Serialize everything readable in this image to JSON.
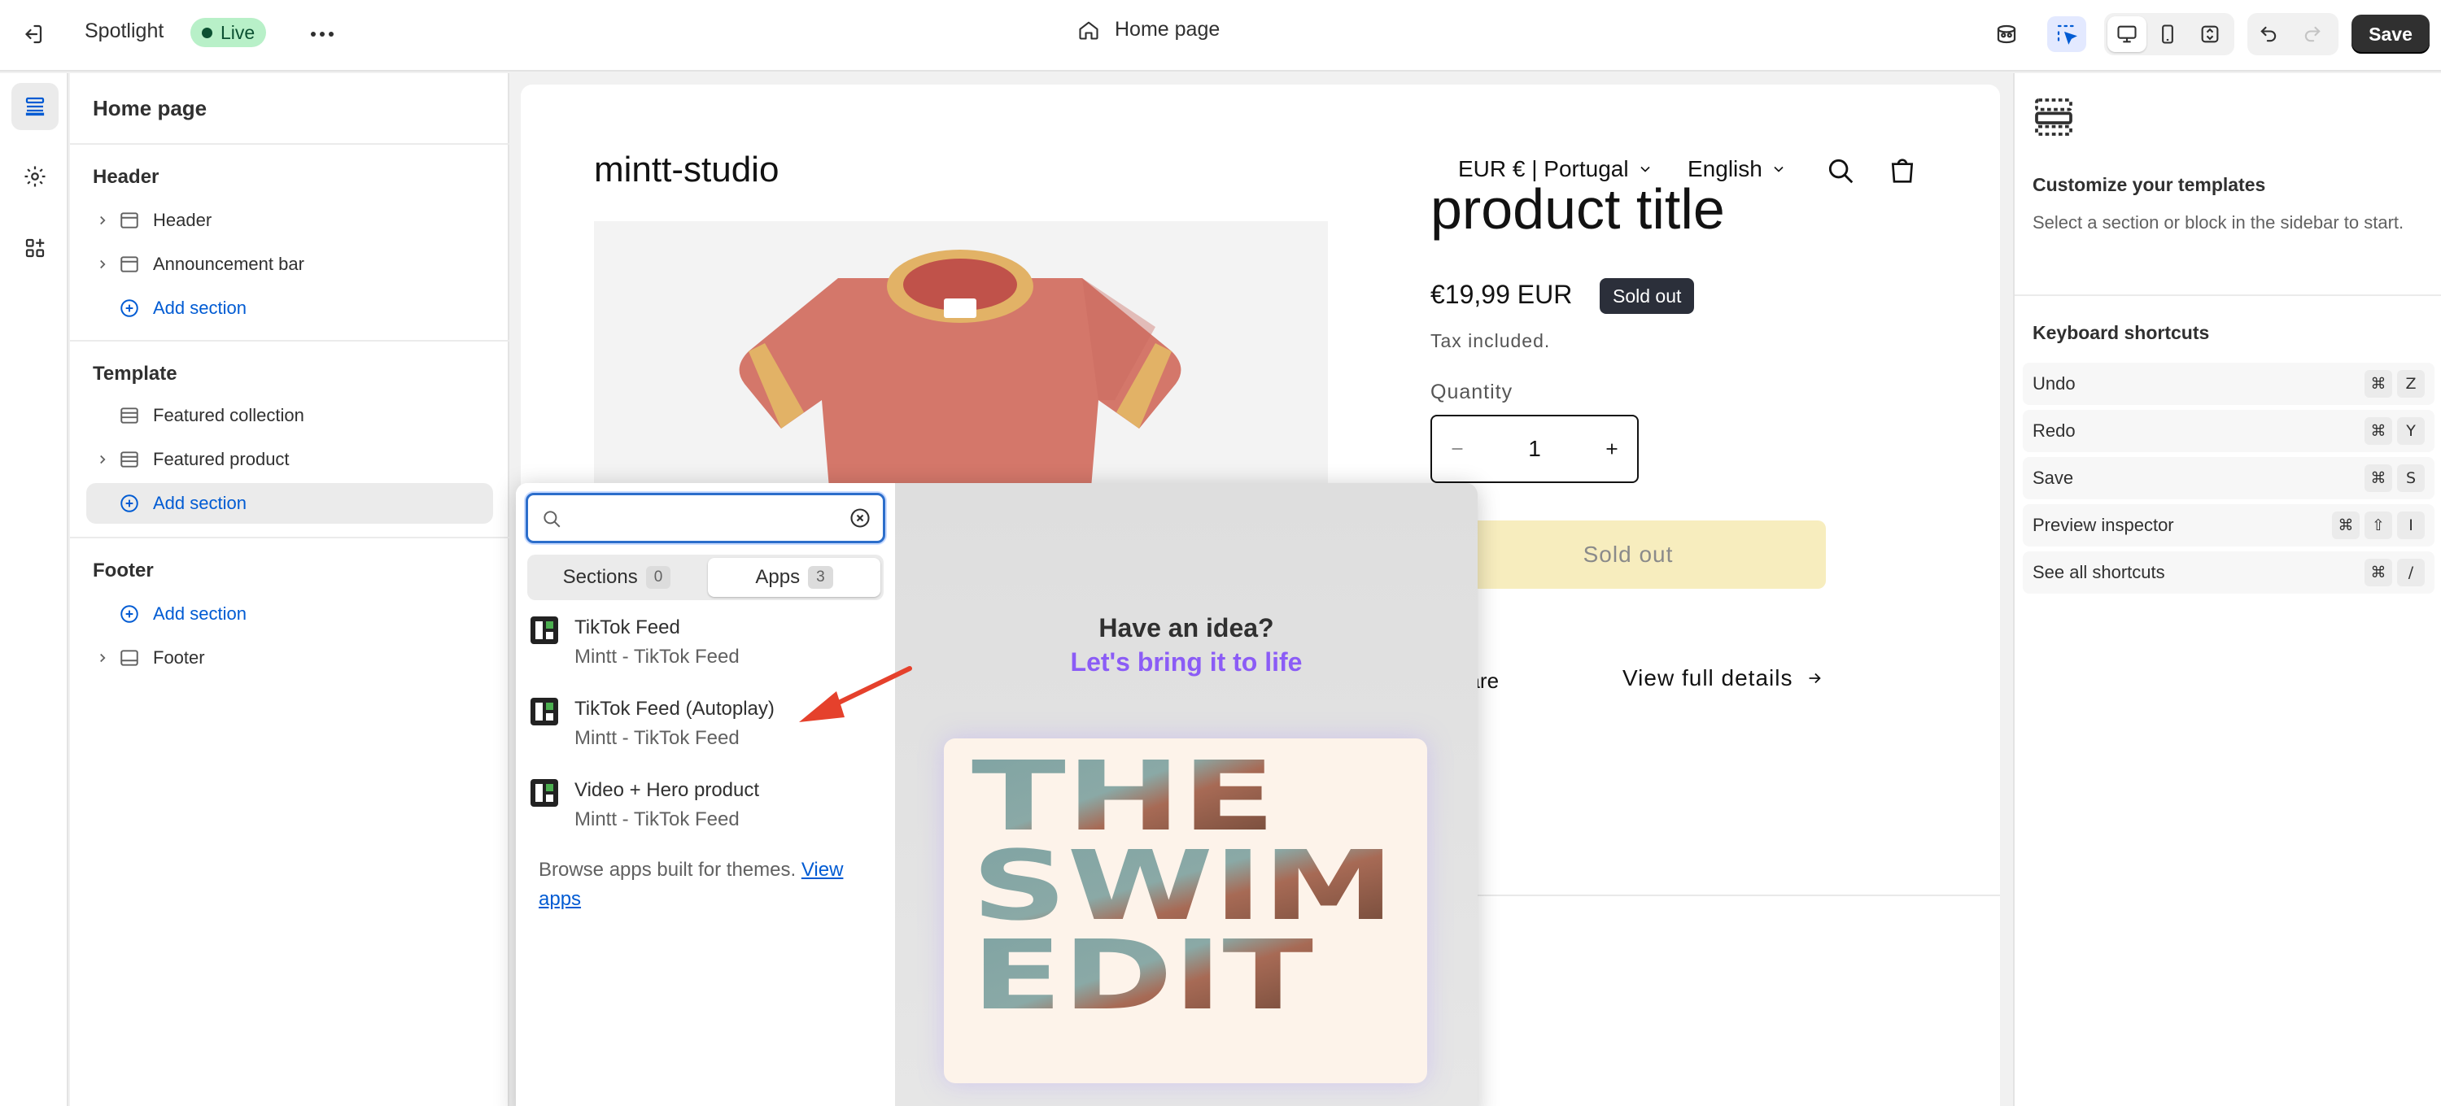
{
  "topbar": {
    "theme_name": "Spotlight",
    "live_badge": "Live",
    "page_selector": "Home page",
    "save_label": "Save"
  },
  "sidebar": {
    "title": "Home page",
    "groups": {
      "header": {
        "label": "Header",
        "items": [
          "Header",
          "Announcement bar"
        ],
        "add_label": "Add section"
      },
      "template": {
        "label": "Template",
        "items": [
          "Featured collection",
          "Featured product"
        ],
        "add_label": "Add section"
      },
      "footer": {
        "label": "Footer",
        "add_label": "Add section",
        "items": [
          "Footer"
        ]
      }
    }
  },
  "preview": {
    "store_name": "mintt-studio",
    "currency": "EUR € | Portugal",
    "language": "English",
    "product_title": "product title",
    "price": "€19,99 EUR",
    "sold_out_badge": "Sold out",
    "tax_note": "Tax included.",
    "quantity_label": "Quantity",
    "quantity_value": "1",
    "sold_out_button": "Sold out",
    "share_label": "hare",
    "view_full_details": "View full details"
  },
  "add_section_popover": {
    "search": {
      "value": "",
      "placeholder": ""
    },
    "tabs": [
      {
        "label": "Sections",
        "count": "0"
      },
      {
        "label": "Apps",
        "count": "3"
      }
    ],
    "selected_tab": "Apps",
    "apps": [
      {
        "name": "TikTok Feed",
        "provider": "Mintt - TikTok Feed"
      },
      {
        "name": "TikTok Feed (Autoplay)",
        "provider": "Mintt - TikTok Feed"
      },
      {
        "name": "Video + Hero product",
        "provider": "Mintt - TikTok Feed"
      }
    ],
    "browse_text": "Browse apps built for themes.",
    "browse_link": "View apps",
    "idea_line1": "Have an idea?",
    "idea_line2": "Let's bring it to life",
    "card_text": [
      "THE",
      "SWIM",
      "EDIT"
    ]
  },
  "right_panel": {
    "title": "Customize your templates",
    "description": "Select a section or block in the sidebar to start.",
    "shortcuts_title": "Keyboard shortcuts",
    "shortcuts": [
      {
        "label": "Undo",
        "keys": [
          "⌘",
          "Z"
        ]
      },
      {
        "label": "Redo",
        "keys": [
          "⌘",
          "Y"
        ]
      },
      {
        "label": "Save",
        "keys": [
          "⌘",
          "S"
        ]
      },
      {
        "label": "Preview inspector",
        "keys": [
          "⌘",
          "⇧",
          "I"
        ]
      },
      {
        "label": "See all shortcuts",
        "keys": [
          "⌘",
          "/"
        ]
      }
    ]
  },
  "colors": {
    "accent_blue": "#005bd3",
    "live_green": "#b8f0c8",
    "sold_out_button": "#f7edbe",
    "idea_purple": "#8b5cf6",
    "arrow_red": "#e5412c"
  }
}
